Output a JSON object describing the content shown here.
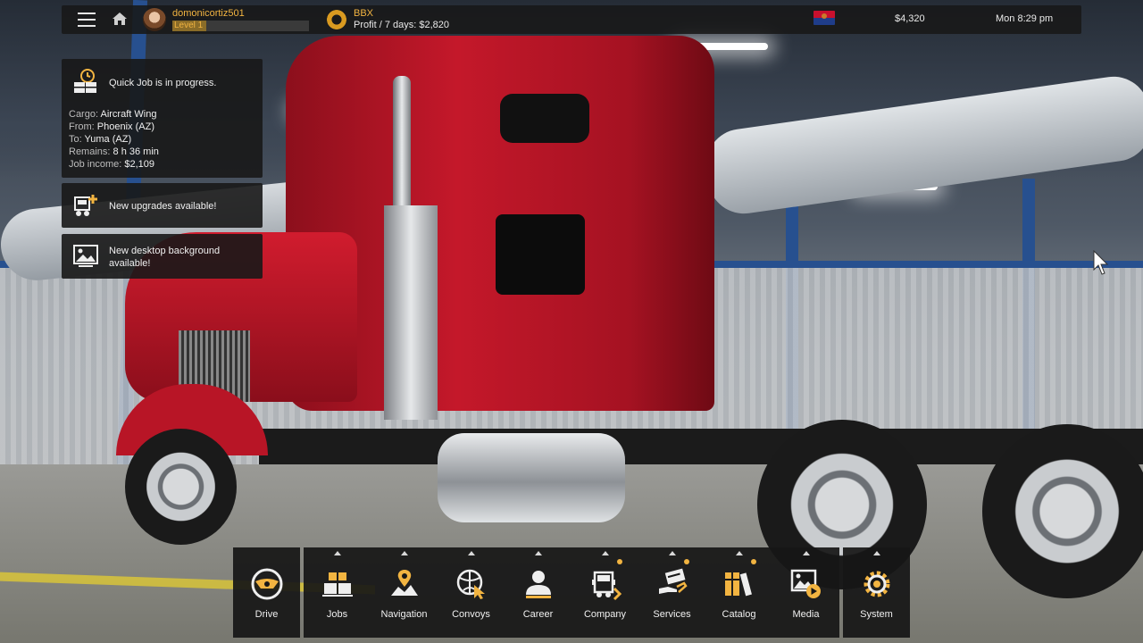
{
  "top_bar": {
    "username": "domonicortiz501",
    "level_label": "Level 1",
    "level_progress": 0.25,
    "company_name": "BBX",
    "profit_text": "Profit / 7 days: $2,820",
    "state_flag": "arizona-flag",
    "money": "$4,320",
    "game_time": "Mon 8:29 pm"
  },
  "notifications": {
    "quick_job": {
      "title": "Quick Job is in progress.",
      "cargo_label": "Cargo:",
      "cargo": "Aircraft Wing",
      "from_label": "From:",
      "from": "Phoenix (AZ)",
      "to_label": "To:",
      "to": "Yuma (AZ)",
      "remains_label": "Remains:",
      "remains": "8 h 36 min",
      "income_label": "Job income:",
      "income": "$2,109"
    },
    "upgrades": {
      "title": "New upgrades available!"
    },
    "desktop_bg": {
      "title": "New desktop background available!"
    }
  },
  "dock": {
    "drive": {
      "label": "Drive",
      "icon": "steering-wheel-icon"
    },
    "items": [
      {
        "label": "Jobs",
        "icon": "crates-icon",
        "has_dot": false
      },
      {
        "label": "Navigation",
        "icon": "map-pin-icon",
        "has_dot": false
      },
      {
        "label": "Convoys",
        "icon": "globe-cursor-icon",
        "has_dot": false
      },
      {
        "label": "Career",
        "icon": "person-icon",
        "has_dot": false
      },
      {
        "label": "Company",
        "icon": "truck-front-icon",
        "has_dot": true
      },
      {
        "label": "Services",
        "icon": "hand-card-icon",
        "has_dot": true
      },
      {
        "label": "Catalog",
        "icon": "books-icon",
        "has_dot": true
      },
      {
        "label": "Media",
        "icon": "picture-play-icon",
        "has_dot": false
      }
    ],
    "system": {
      "label": "System",
      "icon": "gear-icon"
    }
  },
  "colors": {
    "accent": "#f2b441",
    "panel": "#181818"
  }
}
